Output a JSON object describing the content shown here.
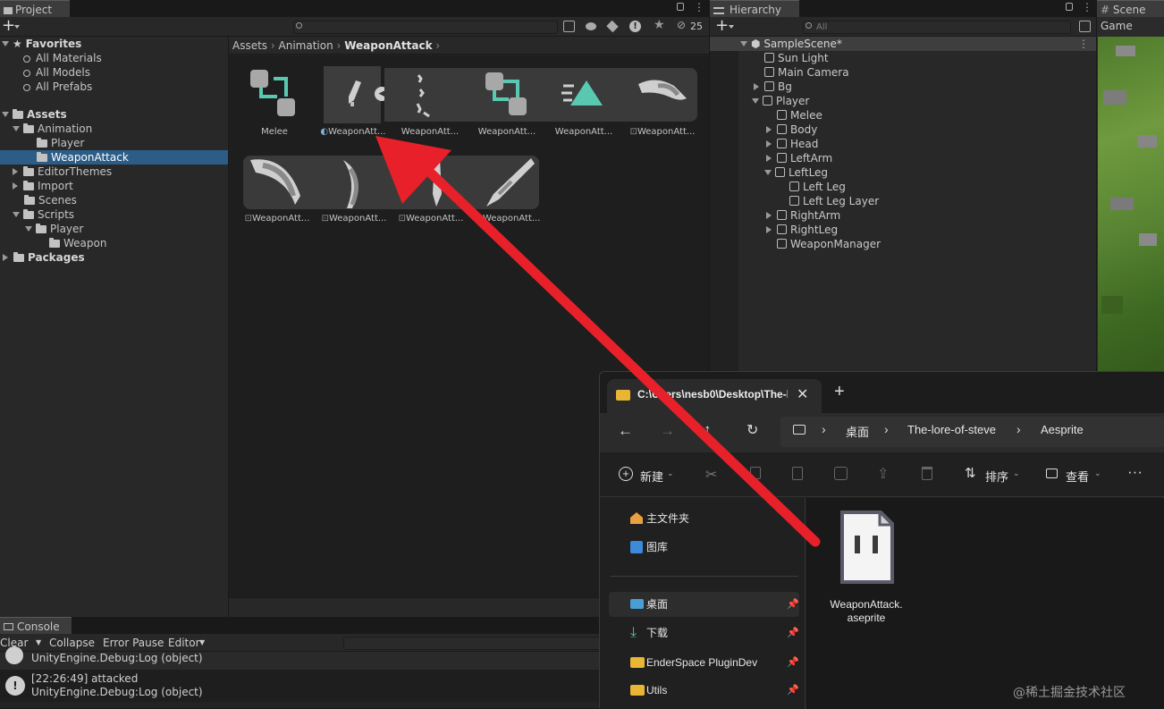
{
  "project_panel": {
    "tab_label": "Project",
    "add_label": "+",
    "hidden_count": "25",
    "breadcrumb": [
      "Assets",
      "Animation",
      "WeaponAttack"
    ],
    "favorites": {
      "label": "Favorites",
      "items": [
        "All Materials",
        "All Models",
        "All Prefabs"
      ]
    },
    "assets_label": "Assets",
    "tree": [
      {
        "label": "Animation",
        "expanded": true
      },
      {
        "label": "Player"
      },
      {
        "label": "WeaponAttack",
        "selected": true
      },
      {
        "label": "EditorThemes"
      },
      {
        "label": "Import"
      },
      {
        "label": "Scenes"
      },
      {
        "label": "Scripts",
        "expanded": true
      },
      {
        "label": "Player",
        "expanded": true
      },
      {
        "label": "Weapon"
      }
    ],
    "packages_label": "Packages",
    "grid_row1": [
      "Melee",
      "WeaponAtt...",
      "WeaponAtt...",
      "WeaponAtt...",
      "WeaponAtt...",
      "WeaponAtt..."
    ],
    "grid_row2": [
      "WeaponAtt...",
      "WeaponAtt...",
      "WeaponAtt...",
      "WeaponAtt..."
    ]
  },
  "hierarchy_panel": {
    "tab_label": "Hierarchy",
    "search_placeholder": "All",
    "scene_name": "SampleScene*",
    "items": [
      {
        "label": "Sun Light",
        "depth": 1
      },
      {
        "label": "Main Camera",
        "depth": 1
      },
      {
        "label": "Bg",
        "depth": 1,
        "collapsed": true
      },
      {
        "label": "Player",
        "depth": 1,
        "expanded": true
      },
      {
        "label": "Melee",
        "depth": 2
      },
      {
        "label": "Body",
        "depth": 2,
        "collapsed": true
      },
      {
        "label": "Head",
        "depth": 2,
        "collapsed": true
      },
      {
        "label": "LeftArm",
        "depth": 2,
        "collapsed": true
      },
      {
        "label": "LeftLeg",
        "depth": 2,
        "expanded": true
      },
      {
        "label": "Left Leg",
        "depth": 3
      },
      {
        "label": "Left Leg Layer",
        "depth": 3
      },
      {
        "label": "RightArm",
        "depth": 2,
        "collapsed": true
      },
      {
        "label": "RightLeg",
        "depth": 2,
        "collapsed": true
      },
      {
        "label": "WeaponManager",
        "depth": 2
      }
    ]
  },
  "scene_panel": {
    "tab_label": "Scene",
    "game_label": "Game"
  },
  "console_panel": {
    "tab_label": "Console",
    "toolbar": [
      "Clear",
      "Collapse",
      "Error Pause",
      "Editor"
    ],
    "logs": [
      {
        "line1": "",
        "line2": "UnityEngine.Debug:Log (object)"
      },
      {
        "line1": "[22:26:49] attacked",
        "line2": "UnityEngine.Debug:Log (object)"
      }
    ]
  },
  "explorer": {
    "tab_title": "C:\\Users\\nesb0\\Desktop\\The-l",
    "path": [
      "桌面",
      "The-lore-of-steve",
      "Aesprite"
    ],
    "new_label": "新建",
    "sort_label": "排序",
    "view_label": "查看",
    "sidebar": [
      {
        "label": "主文件夹",
        "icon": "home-icon"
      },
      {
        "label": "图库",
        "icon": "gallery-icon"
      },
      {
        "label": "桌面",
        "icon": "desktop-icon",
        "selected": true,
        "pinned": true
      },
      {
        "label": "下载",
        "icon": "download-icon",
        "pinned": true
      },
      {
        "label": "EnderSpace PluginDev",
        "icon": "folder-icon",
        "pinned": true
      },
      {
        "label": "Utils",
        "icon": "folder-icon",
        "pinned": true
      }
    ],
    "file": {
      "name_line1": "WeaponAttack.",
      "name_line2": "aseprite"
    }
  },
  "watermark": "@稀土掘金技术社区",
  "colors": {
    "accent_red": "#e8202a",
    "selection_blue": "#2c5d87",
    "mint": "#5ac8b0"
  }
}
